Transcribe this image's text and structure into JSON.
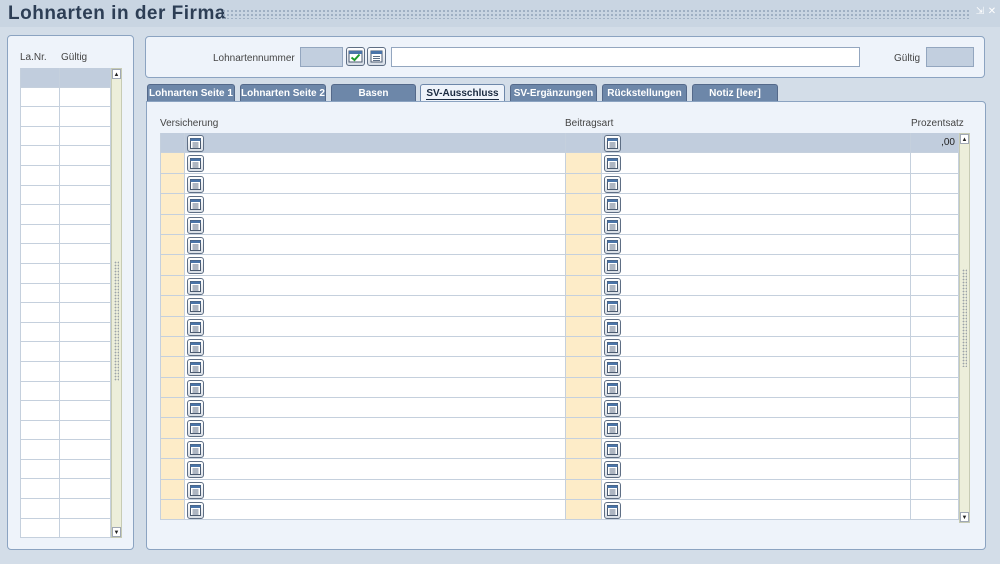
{
  "window": {
    "title": "Lohnarten in der Firma"
  },
  "left_list": {
    "headers": [
      "La.Nr.",
      "Gültig"
    ],
    "row_count": 24,
    "selected_row": 0
  },
  "header_form": {
    "lohnartennummer_label": "Lohnartennummer",
    "lohnartennummer_value": "",
    "description_value": "",
    "gueltig_label": "Gültig",
    "gueltig_value": ""
  },
  "tabs": [
    {
      "label": "Lohnarten Seite 1",
      "active": false
    },
    {
      "label": "Lohnarten Seite 2",
      "active": false
    },
    {
      "label": "Basen",
      "active": false
    },
    {
      "label": "SV-Ausschluss",
      "active": true
    },
    {
      "label": "SV-Ergänzungen",
      "active": false
    },
    {
      "label": "Rückstellungen",
      "active": false
    },
    {
      "label": "Notiz [leer]",
      "active": false
    }
  ],
  "sv_table": {
    "headers": [
      "Versicherung",
      "Beitragsart",
      "Prozentsatz"
    ],
    "row_count": 19,
    "selected_row": 0,
    "first_row_prozentsatz": ",00"
  },
  "colors": {
    "accent": "#6d87a9",
    "panel": "#eef3fa",
    "selected": "#c1cddd",
    "editable_cell": "#fdecc8"
  }
}
